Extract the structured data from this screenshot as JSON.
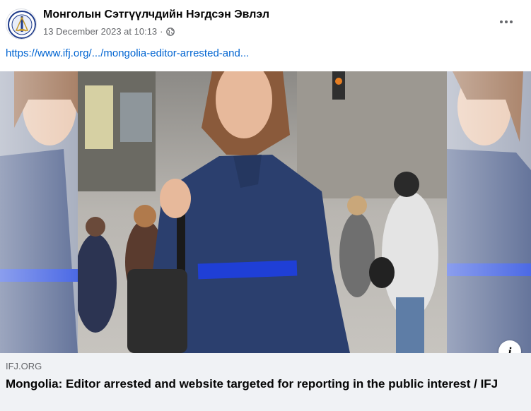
{
  "post": {
    "page_name": "Монголын Сэтгүүлчдийн Нэгдсэн Эвлэл",
    "timestamp": "13 December 2023 at 10:13",
    "separator": "·",
    "audience_icon": "globe-icon",
    "link_text": "https://www.ifj.org/.../mongolia-editor-arrested-and..."
  },
  "link_preview": {
    "domain": "IFJ.ORG",
    "title": "Mongolia: Editor arrested and website targeted for reporting in the public interest / IFJ"
  },
  "icons": {
    "more": "more-options-icon",
    "info": "info-icon"
  },
  "colors": {
    "link": "#0064d1",
    "secondary_text": "#65676b",
    "preview_bg": "#f0f2f5",
    "dress": "#2b3f6e",
    "belt": "#1f3fd6"
  }
}
